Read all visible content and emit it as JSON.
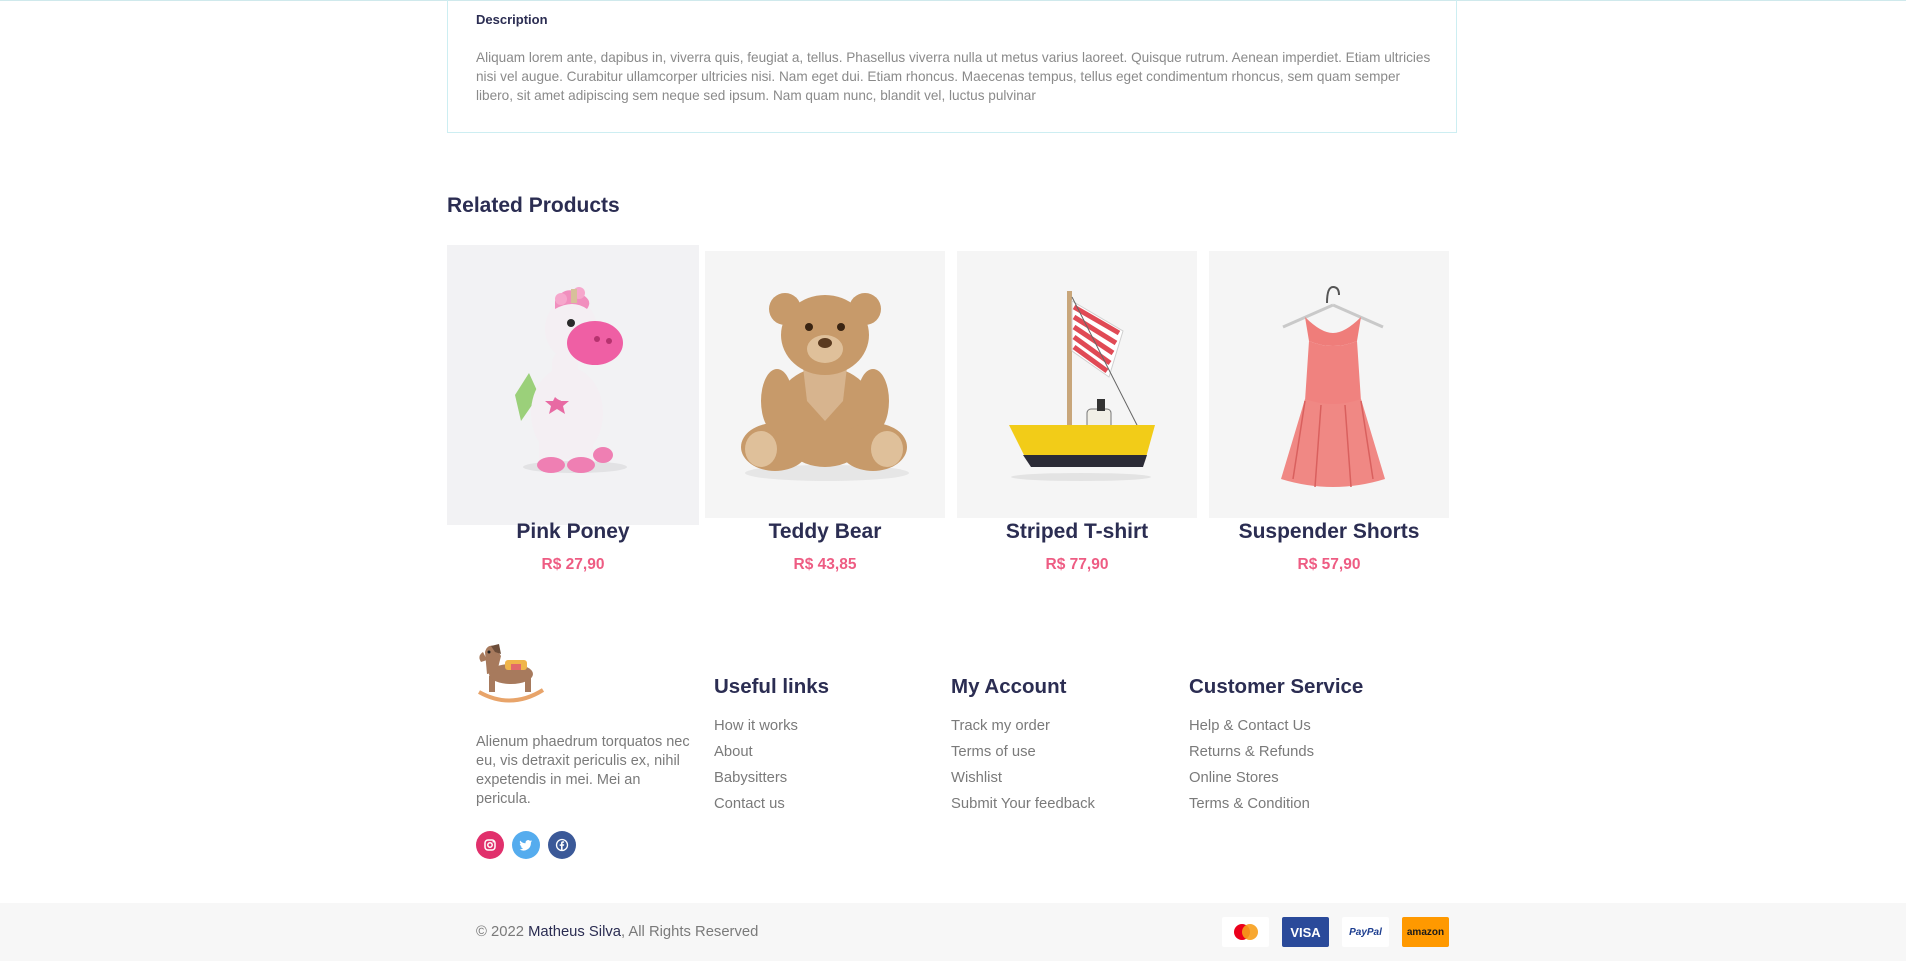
{
  "description": {
    "title": "Description",
    "text": "Aliquam lorem ante, dapibus in, viverra quis, feugiat a, tellus. Phasellus viverra nulla ut metus varius laoreet. Quisque rutrum. Aenean imperdiet. Etiam ultricies nisi vel augue. Curabitur ullamcorper ultricies nisi. Nam eget dui. Etiam rhoncus. Maecenas tempus, tellus eget condimentum rhoncus, sem quam semper libero, sit amet adipiscing sem neque sed ipsum. Nam quam nunc, blandit vel, luctus pulvinar"
  },
  "related": {
    "title": "Related Products",
    "products": [
      {
        "name": "Pink Poney",
        "price": "R$ 27,90",
        "image": "pink-pony-toy"
      },
      {
        "name": "Teddy Bear",
        "price": "R$ 43,85",
        "image": "teddy-bear"
      },
      {
        "name": "Striped T-shirt",
        "price": "R$ 77,90",
        "image": "toy-sailboat"
      },
      {
        "name": "Suspender Shorts",
        "price": "R$ 57,90",
        "image": "pink-dress"
      }
    ]
  },
  "footer": {
    "logo": "rocking-horse-icon",
    "about": "Alienum phaedrum torquatos nec eu, vis detraxit periculis ex, nihil expetendis in mei. Mei an pericula.",
    "socials": [
      {
        "name": "instagram-icon",
        "color": "#e1306c"
      },
      {
        "name": "twitter-icon",
        "color": "#55acee"
      },
      {
        "name": "facebook-icon",
        "color": "#3b5998"
      }
    ],
    "columns": [
      {
        "title": "Useful links",
        "links": [
          "How it works",
          "About",
          "Babysitters",
          "Contact us"
        ]
      },
      {
        "title": "My Account",
        "links": [
          "Track my order",
          "Terms of use",
          "Wishlist",
          "Submit Your feedback"
        ]
      },
      {
        "title": "Customer Service",
        "links": [
          "Help & Contact Us",
          "Returns & Refunds",
          "Online Stores",
          "Terms & Condition"
        ]
      }
    ]
  },
  "bottom": {
    "copyright_prefix": "© 2022",
    "author": "Matheus Silva",
    "copyright_suffix": ", All Rights Reserved",
    "payments": [
      {
        "name": "mastercard-icon",
        "label": ""
      },
      {
        "name": "visa-icon",
        "label": "VISA"
      },
      {
        "name": "paypal-icon",
        "label": "PayPal"
      },
      {
        "name": "amazon-icon",
        "label": "amazon"
      }
    ]
  },
  "colors": {
    "heading": "#2b2d52",
    "price": "#ee5c83",
    "muted_text": "#7a7a7a",
    "border": "#cdeef2"
  }
}
